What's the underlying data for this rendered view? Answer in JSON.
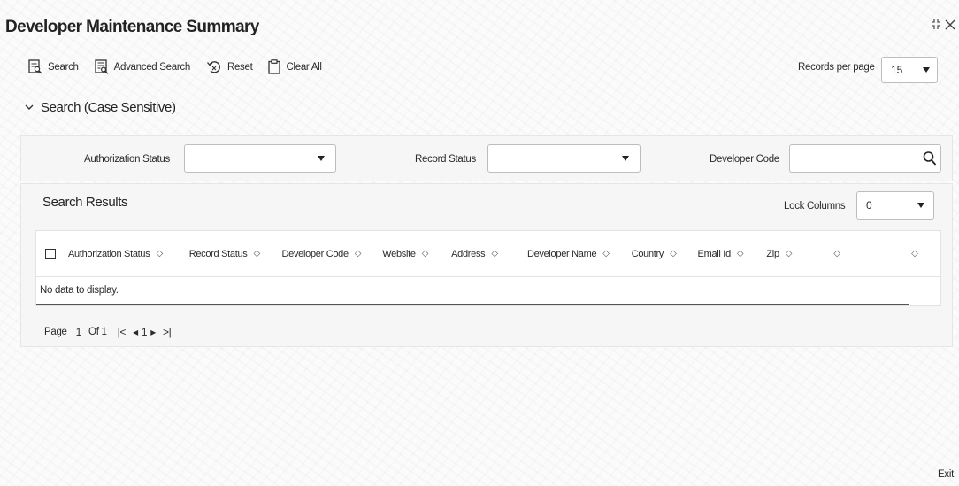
{
  "header": {
    "title": "Developer Maintenance Summary"
  },
  "toolbar": {
    "search_label": "Search",
    "advanced_search_label": "Advanced Search",
    "reset_label": "Reset",
    "clear_all_label": "Clear All",
    "records_per_page_label": "Records per page",
    "records_per_page_value": "15"
  },
  "search_section": {
    "title": "Search (Case Sensitive)",
    "fields": {
      "authorization_status_label": "Authorization Status",
      "record_status_label": "Record Status",
      "developer_code_label": "Developer Code"
    }
  },
  "results": {
    "title": "Search Results",
    "lock_columns_label": "Lock Columns",
    "lock_columns_value": "0",
    "columns": [
      "Authorization Status",
      "Record Status",
      "Developer Code",
      "Website",
      "Address",
      "Developer Name",
      "Country",
      "Email Id",
      "Zip",
      "",
      ""
    ],
    "no_data_text": "No data to display.",
    "pagination": {
      "page_label": "Page",
      "current_page": "1",
      "of_label": "Of 1",
      "page_link": "1"
    }
  },
  "footer": {
    "exit_label": "Exit"
  },
  "icons": [
    "search-icon",
    "advanced-search-icon",
    "reset-icon",
    "clear-all-icon",
    "magnifier-icon",
    "chevron-down-icon",
    "sort-icon",
    "first-page-icon",
    "prev-page-icon",
    "next-page-icon",
    "last-page-icon",
    "collapse-icon",
    "close-icon"
  ]
}
